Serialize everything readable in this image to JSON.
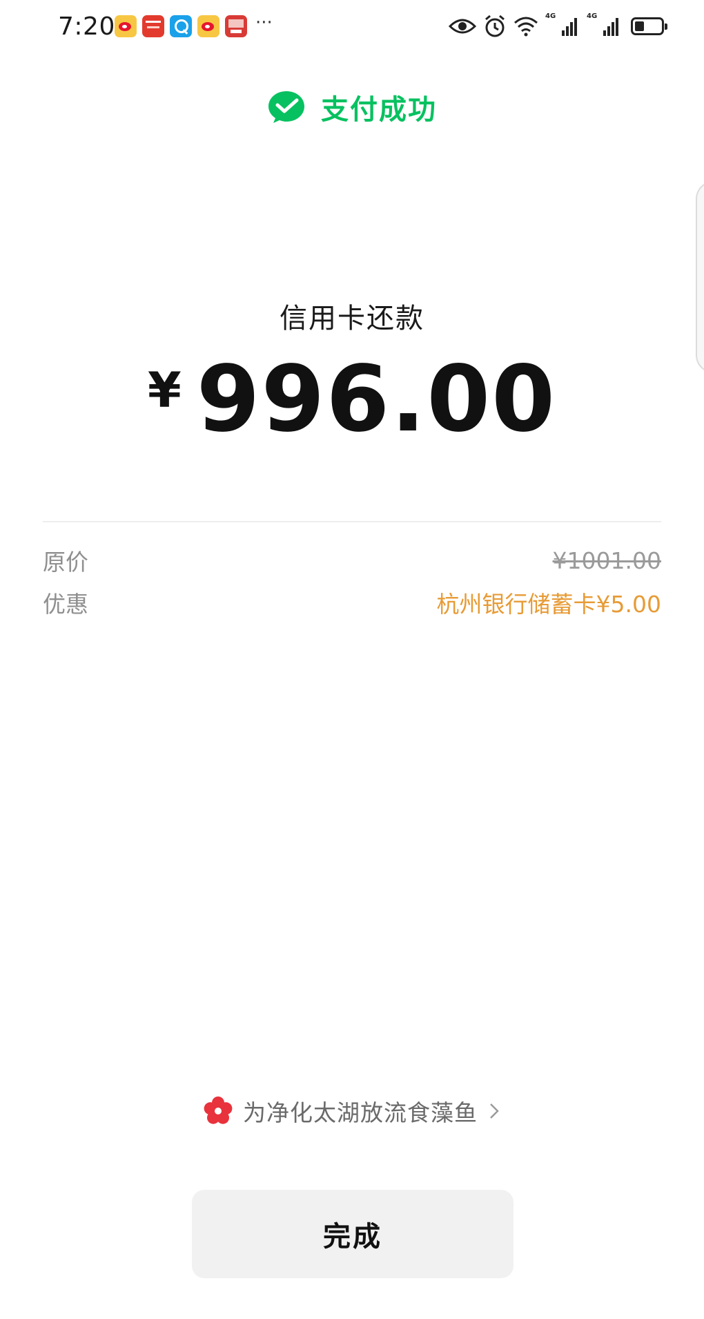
{
  "status_bar": {
    "time": "7:20",
    "notification_icons": [
      "weibo-icon",
      "red-app-icon",
      "search-app-icon",
      "weibo-icon",
      "news-app-icon"
    ],
    "more_indicator": "···",
    "network_labels": [
      "4G",
      "4G"
    ],
    "battery_level": 0.35
  },
  "header": {
    "icon": "wechat-pay-check-icon",
    "title": "支付成功"
  },
  "payment": {
    "type": "信用卡还款",
    "currency_symbol": "¥",
    "amount": "996.00"
  },
  "details": [
    {
      "label": "原价",
      "value": "¥1001.00",
      "style": "strikethrough"
    },
    {
      "label": "优惠",
      "value": "杭州银行储蓄卡¥5.00",
      "style": "discount"
    }
  ],
  "promo": {
    "icon": "red-flower-icon",
    "text": "为净化太湖放流食藻鱼"
  },
  "done_button": {
    "label": "完成"
  },
  "colors": {
    "success_green": "#07c160",
    "discount_orange": "#e79b35",
    "flower_red": "#e8323c",
    "button_bg": "#f1f1f1"
  }
}
